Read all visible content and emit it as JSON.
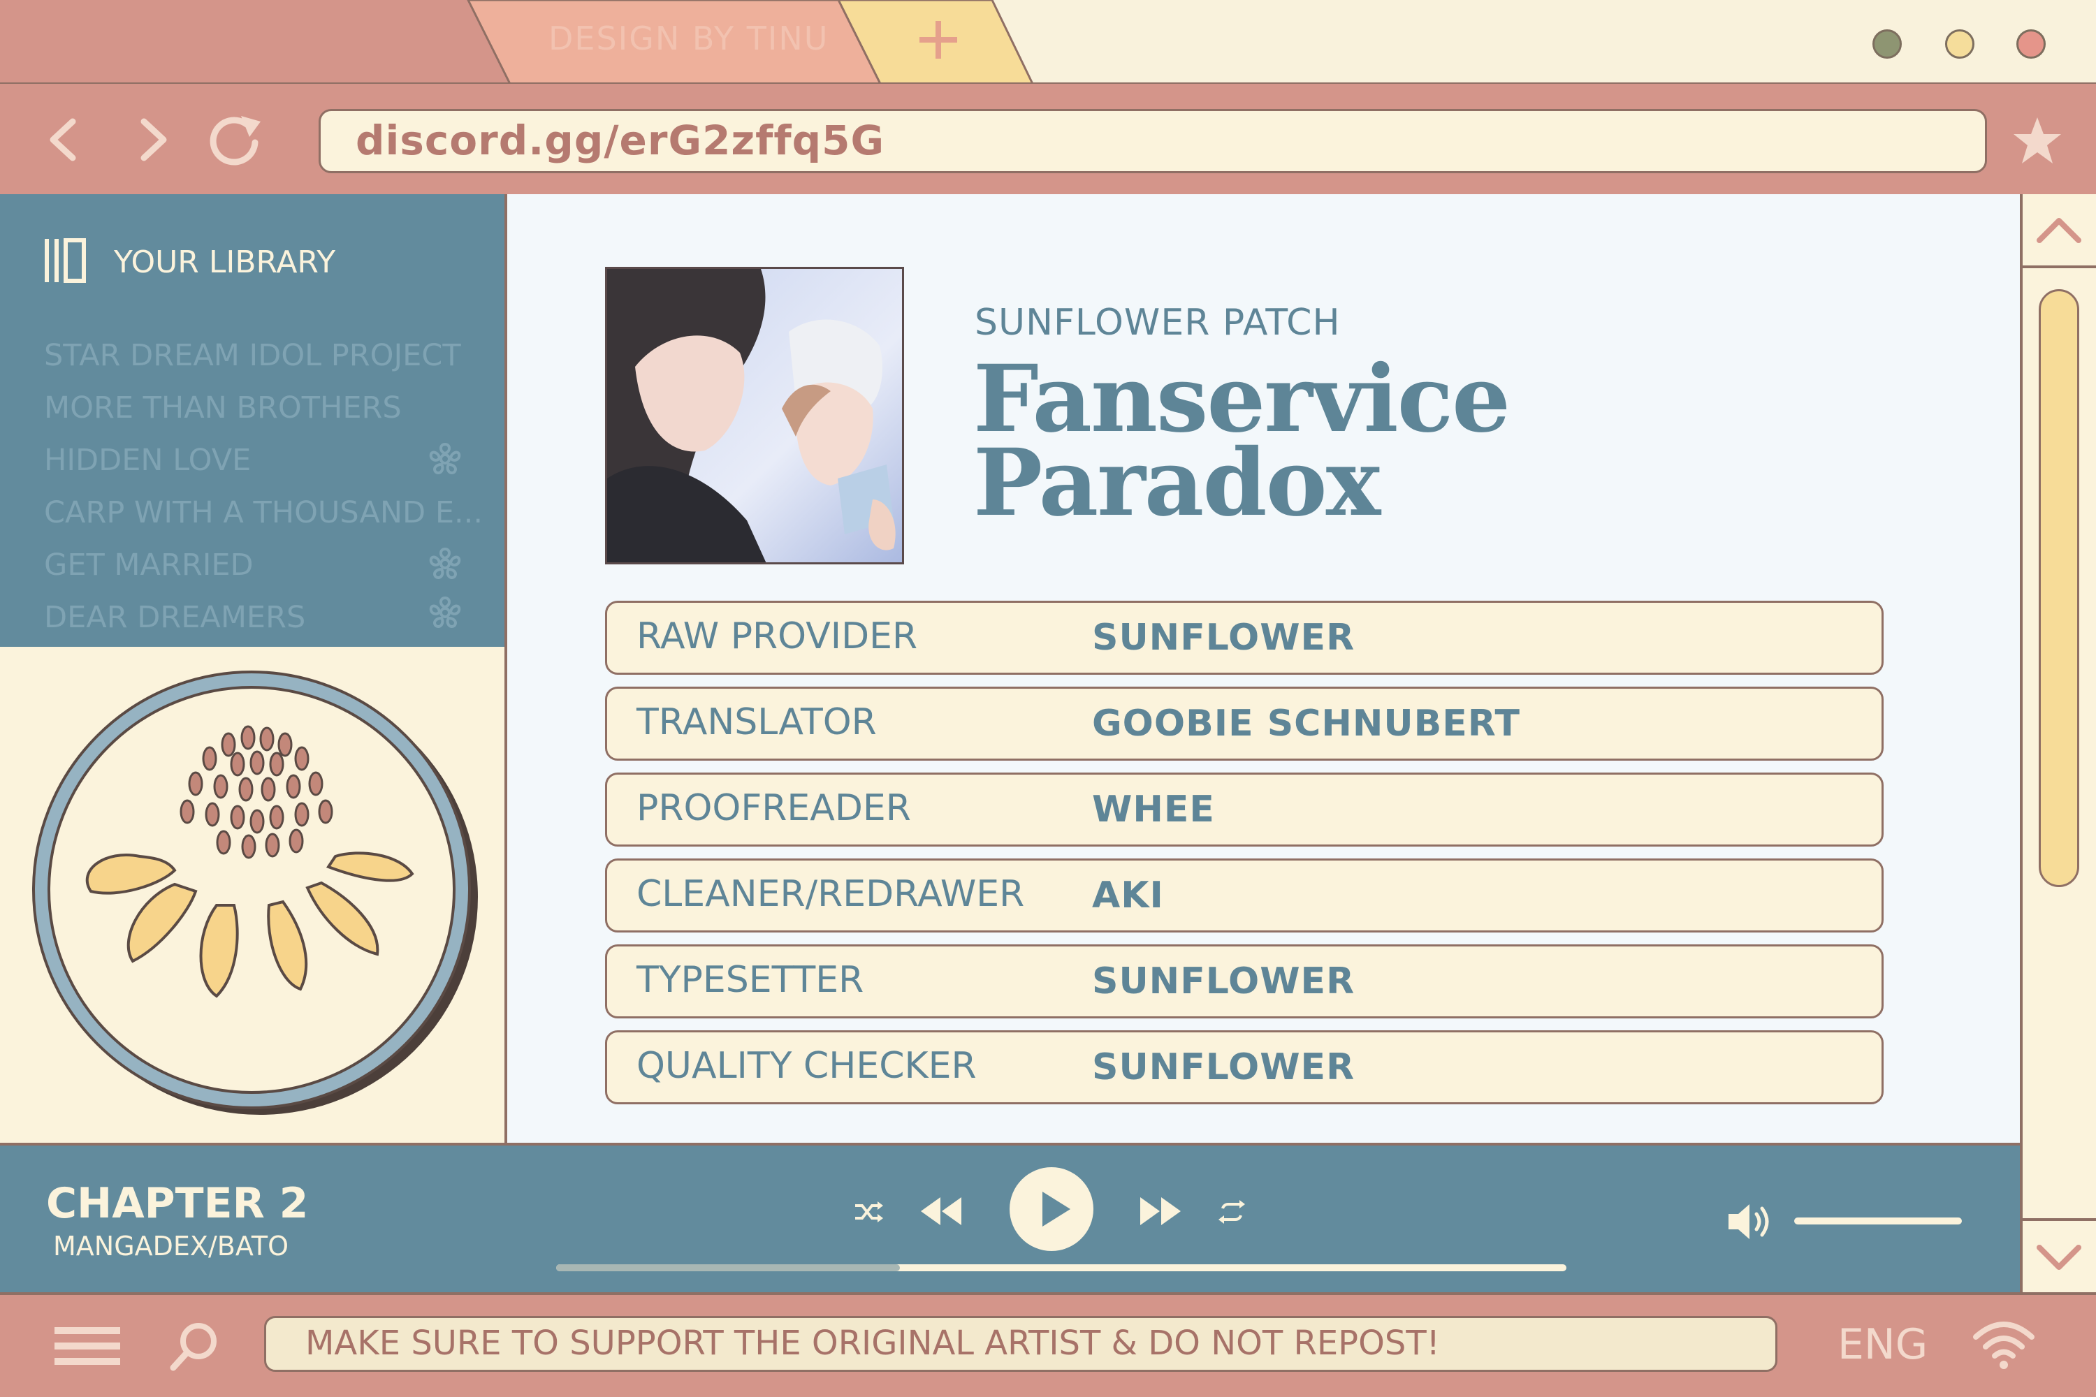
{
  "browser": {
    "tabs": [
      {
        "label": "DESIGN BY TINU"
      }
    ],
    "new_tab_symbol": "+",
    "window_dots": [
      "#8e9572",
      "#f5dd9b",
      "#e5958a"
    ],
    "url": "discord.gg/erG2zffq5G",
    "icons": {
      "back": "chevron-left-icon",
      "forward": "chevron-right-icon",
      "reload": "reload-icon",
      "bookmark": "star-icon"
    }
  },
  "sidebar": {
    "title": "YOUR LIBRARY",
    "items": [
      {
        "label": "STAR DREAM IDOL PROJECT",
        "flagged": false
      },
      {
        "label": "MORE THAN BROTHERS",
        "flagged": false
      },
      {
        "label": "HIDDEN LOVE",
        "flagged": true
      },
      {
        "label": "CARP WITH A THOUSAND E...",
        "flagged": false
      },
      {
        "label": "GET MARRIED",
        "flagged": true
      },
      {
        "label": "DEAR DREAMERS",
        "flagged": true
      }
    ]
  },
  "series": {
    "group": "SUNFLOWER PATCH",
    "title_line1": "Fanservice",
    "title_line2": "Paradox"
  },
  "credits": [
    {
      "role": "RAW PROVIDER",
      "name": "SUNFLOWER"
    },
    {
      "role": "TRANSLATOR",
      "name": "GOOBIE SCHNUBERT"
    },
    {
      "role": "PROOFREADER",
      "name": "WHEE"
    },
    {
      "role": "CLEANER/REDRAWER",
      "name": "AKI"
    },
    {
      "role": "TYPESETTER",
      "name": "SUNFLOWER"
    },
    {
      "role": "QUALITY CHECKER",
      "name": "SUNFLOWER"
    }
  ],
  "player": {
    "chapter": "CHAPTER 2",
    "source": "MANGADEX/BATO",
    "progress": 0.34,
    "volume": 1.0
  },
  "status_bar": {
    "notice": "MAKE SURE TO SUPPORT THE ORIGINAL ARTIST & DO NOT REPOST!",
    "language": "ENG"
  },
  "colors": {
    "blue": "#628b9d",
    "cream": "#fbf3dc",
    "rose": "#d4958a",
    "yellow": "#f7dc98"
  }
}
